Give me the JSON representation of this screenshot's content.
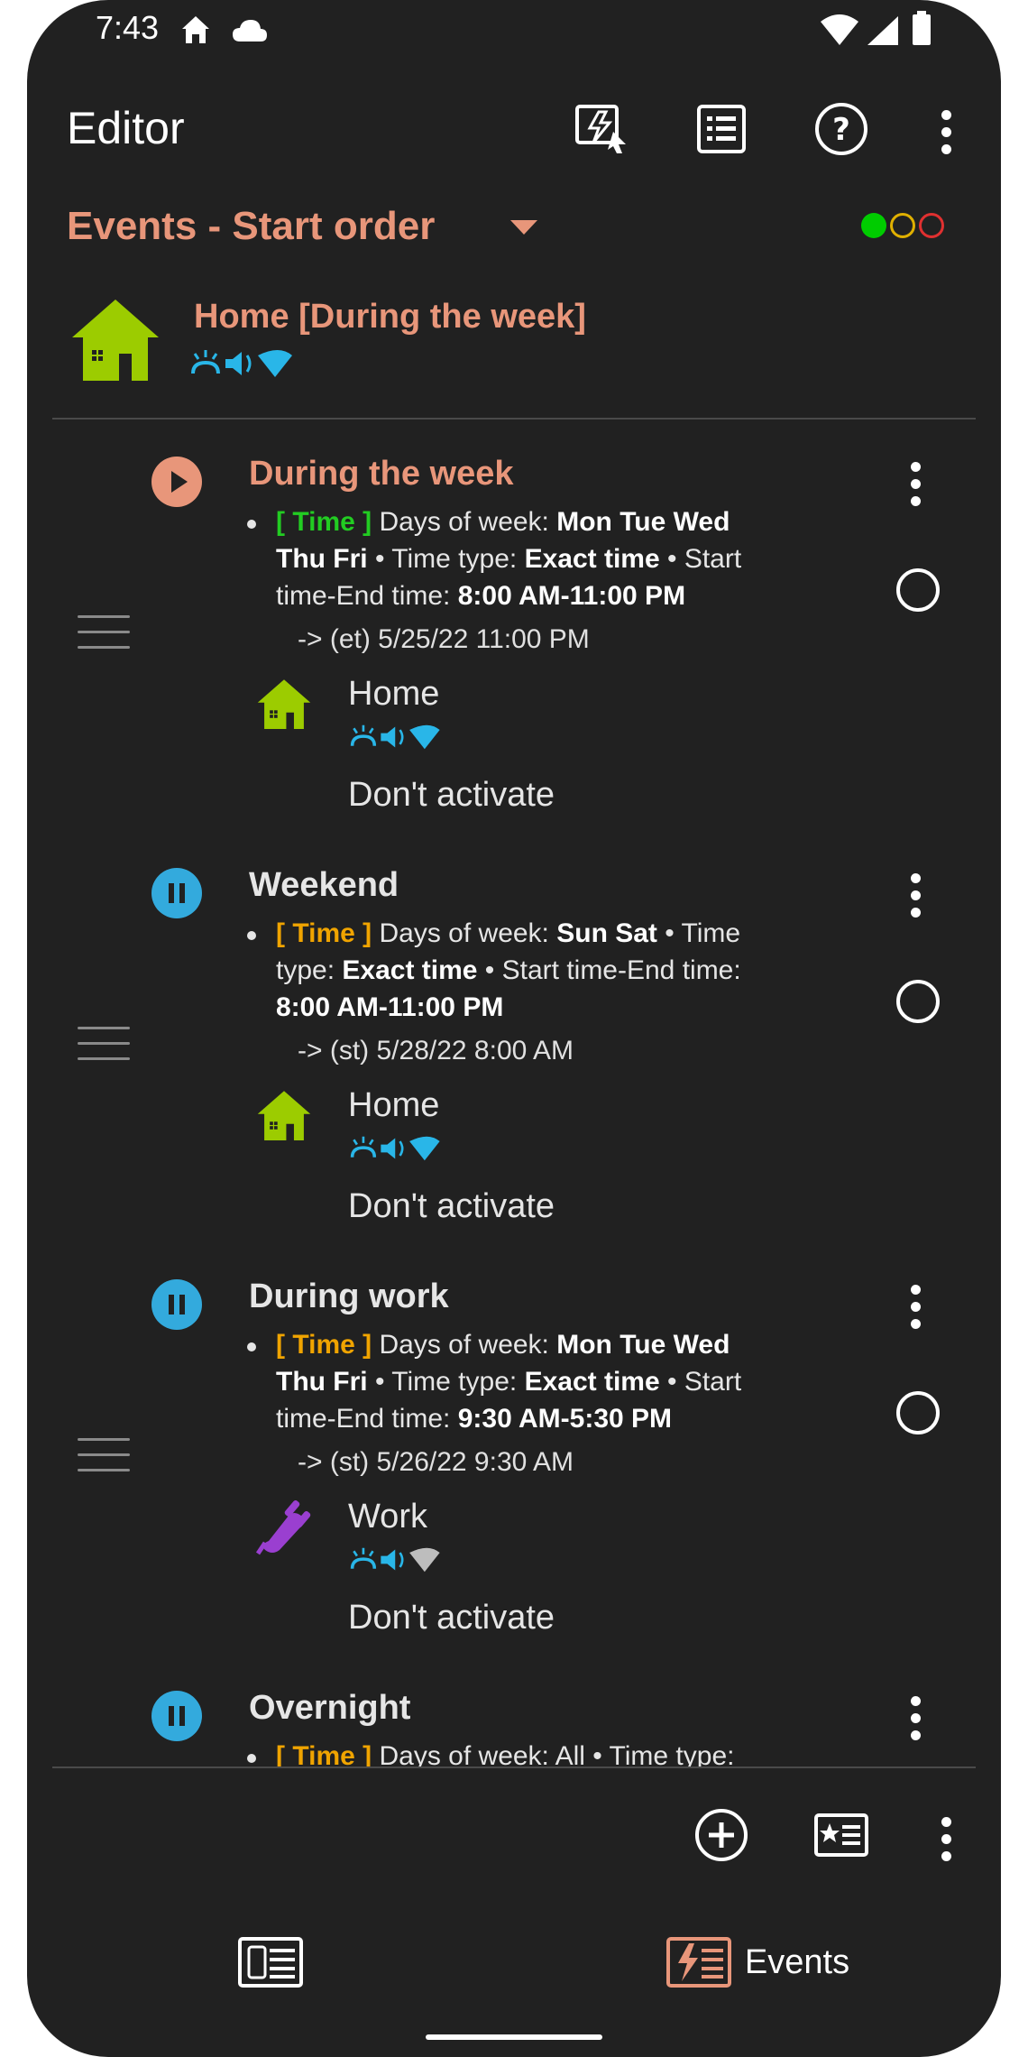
{
  "status_bar": {
    "time": "7:43"
  },
  "toolbar": {
    "title": "Editor",
    "icons": [
      "activate-profile-icon",
      "list-icon",
      "help-icon",
      "more-icon"
    ]
  },
  "filter": {
    "selected": "Events - Start order",
    "indicator_colors": [
      "#00cc00",
      "#e0b000",
      "#e03030"
    ]
  },
  "active_profile": {
    "name": "Home [During the week]",
    "icon": "house-icon",
    "color": "#9ccc00"
  },
  "events": [
    {
      "name": "During the week",
      "status": "running",
      "name_color": "#e8967a",
      "status_color": "#e8967a",
      "time_tag": "[ Time ]",
      "time_color": "#22cc22",
      "desc_lines": [
        [
          "Days of week: ",
          "Mon Tue Wed"
        ],
        [
          "Thu Fri",
          " • Time type: ",
          "Exact time",
          " • Start"
        ],
        [
          "time-End time: ",
          "8:00 AM-11:00 PM"
        ]
      ],
      "next": "-> (et) 5/25/22 11:00 PM",
      "profile": "Home",
      "profile_icon": "house-icon",
      "dont_activate": "Don't activate"
    },
    {
      "name": "Weekend",
      "status": "paused",
      "name_color": "#e6e6e6",
      "status_color": "#33aadd",
      "time_tag": "[ Time ]",
      "time_color": "#f0a400",
      "desc_lines": [
        [
          "Days of week: ",
          "Sun Sat",
          " • Time"
        ],
        [
          "type: ",
          "Exact time",
          " • Start time-End time:"
        ],
        [
          "8:00 AM-11:00 PM"
        ]
      ],
      "next": "-> (st) 5/28/22 8:00 AM",
      "profile": "Home",
      "profile_icon": "house-icon",
      "dont_activate": "Don't activate"
    },
    {
      "name": "During work",
      "status": "paused",
      "name_color": "#e6e6e6",
      "status_color": "#33aadd",
      "time_tag": "[ Time ]",
      "time_color": "#f0a400",
      "desc_lines": [
        [
          "Days of week: ",
          "Mon Tue Wed"
        ],
        [
          "Thu Fri",
          " • Time type: ",
          "Exact time",
          " • Start"
        ],
        [
          "time-End time: ",
          "9:30 AM-5:30 PM"
        ]
      ],
      "next": "-> (st) 5/26/22 9:30 AM",
      "profile": "Work",
      "profile_icon": "plug-icon",
      "dont_activate": "Don't activate"
    },
    {
      "name": "Overnight",
      "status": "paused",
      "name_color": "#e6e6e6",
      "status_color": "#33aadd",
      "time_tag": "[ Time ]",
      "time_color": "#f0a400",
      "partial_line": "Days of week: All • Time type:"
    }
  ],
  "bottom_toolbar": {
    "icons": [
      "add-event-icon",
      "event-list-icon",
      "more-icon"
    ]
  },
  "tabs": [
    {
      "label": "",
      "icon": "profiles-tab-icon",
      "selected": false
    },
    {
      "label": "Events",
      "icon": "events-tab-icon",
      "selected": true
    }
  ]
}
